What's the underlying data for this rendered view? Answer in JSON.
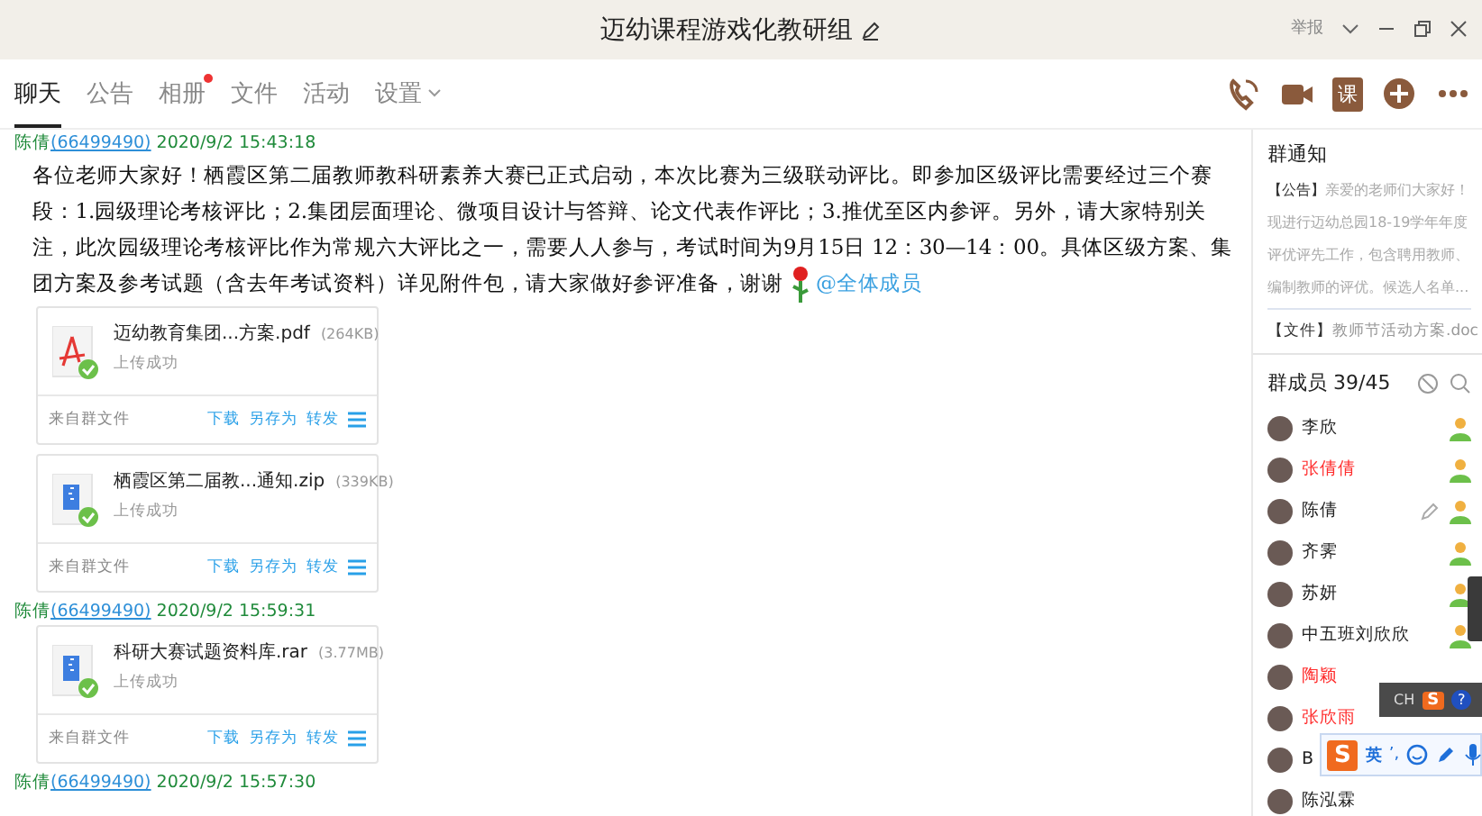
{
  "window": {
    "title": "迈幼课程游戏化教研组",
    "report": "举报"
  },
  "tabs": [
    {
      "label": "聊天",
      "selected": true,
      "dot": false
    },
    {
      "label": "公告",
      "selected": false,
      "dot": false
    },
    {
      "label": "相册",
      "selected": false,
      "dot": true
    },
    {
      "label": "文件",
      "selected": false,
      "dot": false
    },
    {
      "label": "活动",
      "selected": false,
      "dot": false
    },
    {
      "label": "设置",
      "selected": false,
      "dot": false,
      "dropdown": true
    }
  ],
  "toolbar": [
    {
      "kind": "phone"
    },
    {
      "kind": "video"
    },
    {
      "kind": "lesson",
      "label": "课"
    },
    {
      "kind": "plus"
    },
    {
      "kind": "more"
    }
  ],
  "messages": [
    {
      "sender": "陈倩",
      "qq": "(66499490)",
      "time": "2020/9/2 15:43:18",
      "kind": "text",
      "text": "各位老师大家好！栖霞区第二届教师教科研素养大赛已正式启动，本次比赛为三级联动评比。即参加区级评比需要经过三个赛段：1.园级理论考核评比；2.集团层面理论、微项目设计与答辩、论文代表作评比；3.推优至区内参评。另外，请大家特别关注，此次园级理论考核评比作为常规六大评比之一，需要人人参与，考试时间为9月15日 12：30—14：00。具体区级方案、集团方案及参考试题（含去年考试资料）详见附件包，请大家做好参评准备，谢谢",
      "mention": "@全体成员"
    },
    {
      "kind": "pdf_file",
      "name": "迈幼教育集团...方案.pdf",
      "size": "(264KB)",
      "status": "上传成功",
      "source": "来自群文件",
      "actions": [
        "下载",
        "另存为",
        "转发"
      ]
    },
    {
      "kind": "archive_file",
      "name": "栖霞区第二届教...通知.zip",
      "size": "(339KB)",
      "status": "上传成功",
      "source": "来自群文件",
      "actions": [
        "下载",
        "另存为",
        "转发"
      ]
    },
    {
      "sender": "陈倩",
      "qq": "(66499490)",
      "time": "2020/9/2 15:59:31",
      "kind": "archive_file",
      "name": "科研大赛试题资料库.rar",
      "size": "(3.77MB)",
      "status": "上传成功",
      "source": "来自群文件",
      "actions": [
        "下载",
        "另存为",
        "转发"
      ]
    },
    {
      "sender": "陈倩",
      "qq": "(66499490)",
      "time": "2020/9/2 15:57:30",
      "kind": "header"
    }
  ],
  "notice": {
    "title": "群通知",
    "announcement_tag": "【公告】",
    "announcement": "亲爱的老师们大家好！现进行迈幼总园18-19学年年度评优评先工作，包含聘用教师、编制教师的评优。候选人名单...",
    "file_tag": "【文件】",
    "file": "教师节活动方案.doc"
  },
  "members": {
    "title": "群成员 39/45",
    "list": [
      {
        "name": "李欣",
        "color": "#222222",
        "admin": true,
        "editable": false
      },
      {
        "name": "张倩倩",
        "color": "#ff2d2d",
        "admin": true,
        "editable": false
      },
      {
        "name": "陈倩",
        "color": "#222222",
        "admin": true,
        "editable": true
      },
      {
        "name": "齐霁",
        "color": "#222222",
        "admin": true,
        "editable": false
      },
      {
        "name": "苏妍",
        "color": "#222222",
        "admin": true,
        "editable": false
      },
      {
        "name": "中五班刘欣欣",
        "color": "#222222",
        "admin": true,
        "editable": false
      },
      {
        "name": "陶颖",
        "color": "#ff2d2d",
        "admin": false,
        "editable": false
      },
      {
        "name": "张欣雨",
        "color": "#ff2d2d",
        "admin": false,
        "editable": false
      },
      {
        "name": "B",
        "color": "#222222",
        "admin": false,
        "editable": false
      },
      {
        "name": "陈泓霖",
        "color": "#222222",
        "admin": false,
        "editable": false
      }
    ]
  },
  "ime": {
    "status_bar": {
      "language": "CH",
      "logo": "S",
      "help": "?"
    },
    "candidate_bar": {
      "logo": "S",
      "mode": "英",
      "punct": "’,"
    }
  }
}
